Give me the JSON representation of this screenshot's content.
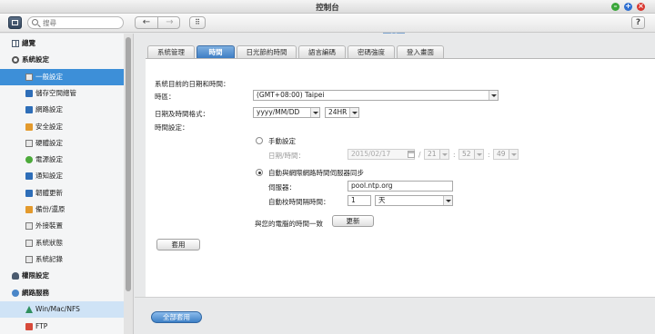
{
  "window": {
    "title": "控制台"
  },
  "toolbar": {
    "search_placeholder": "搜尋",
    "back": "←",
    "forward": "→",
    "apps": "⠿",
    "help": "?"
  },
  "sidebar": {
    "items": [
      {
        "label": "總覽",
        "type": "cat",
        "icon": "grid-icon"
      },
      {
        "label": "系統設定",
        "type": "cat",
        "icon": "gear-icon"
      },
      {
        "label": "一般設定",
        "type": "sub",
        "icon": "general-settings-icon",
        "active": true
      },
      {
        "label": "儲存空間總管",
        "type": "sub",
        "icon": "storage-icon"
      },
      {
        "label": "網路設定",
        "type": "sub",
        "icon": "network-icon"
      },
      {
        "label": "安全設定",
        "type": "sub",
        "icon": "security-icon"
      },
      {
        "label": "硬體設定",
        "type": "sub",
        "icon": "hardware-icon"
      },
      {
        "label": "電源設定",
        "type": "sub",
        "icon": "power-icon"
      },
      {
        "label": "通知設定",
        "type": "sub",
        "icon": "notification-icon"
      },
      {
        "label": "韌體更新",
        "type": "sub",
        "icon": "firmware-icon"
      },
      {
        "label": "備份/還原",
        "type": "sub",
        "icon": "backup-icon"
      },
      {
        "label": "外接裝置",
        "type": "sub",
        "icon": "external-device-icon"
      },
      {
        "label": "系統狀態",
        "type": "sub",
        "icon": "system-status-icon"
      },
      {
        "label": "系統記錄",
        "type": "sub",
        "icon": "system-log-icon"
      },
      {
        "label": "權限設定",
        "type": "cat",
        "icon": "user-icon"
      },
      {
        "label": "網路服務",
        "type": "cat",
        "icon": "globe-icon"
      },
      {
        "label": "Win/Mac/NFS",
        "type": "sub",
        "icon": "win-mac-nfs-icon",
        "hover": true
      },
      {
        "label": "FTP",
        "type": "sub",
        "icon": "ftp-icon"
      }
    ]
  },
  "tabs": [
    {
      "label": "系統管理"
    },
    {
      "label": "時間",
      "active": true
    },
    {
      "label": "日光節約時間"
    },
    {
      "label": "語言編碼"
    },
    {
      "label": "密碼強度"
    },
    {
      "label": "登入畫面"
    }
  ],
  "form": {
    "section_title": "系統目前的日期和時間：",
    "timezone_label": "時區：",
    "timezone_value": "(GMT+08:00) Taipei",
    "format_label": "日期及時間格式：",
    "date_format": "yyyy/MM/DD",
    "hour_format": "24HR",
    "time_setting_label": "時間設定：",
    "manual_label": "手動設定",
    "manual_date_label": "日期/時間：",
    "manual_date": "2015/02/17",
    "manual_hour": "21",
    "manual_minute": "52",
    "manual_second": "49",
    "sep_slash": "/",
    "sep_colon1": ":",
    "sep_colon2": ":",
    "auto_label": "自動與網際網路時間伺服器同步",
    "server_label": "伺服器：",
    "server_value": "pool.ntp.org",
    "interval_label": "自動校時間隔時間：",
    "interval_value": "1",
    "interval_unit": "天",
    "sync_pc_label": "與您的電腦的時間一致",
    "update_button": "更新",
    "apply_button": "套用"
  },
  "footer": {
    "apply_all_button": "全部套用"
  }
}
